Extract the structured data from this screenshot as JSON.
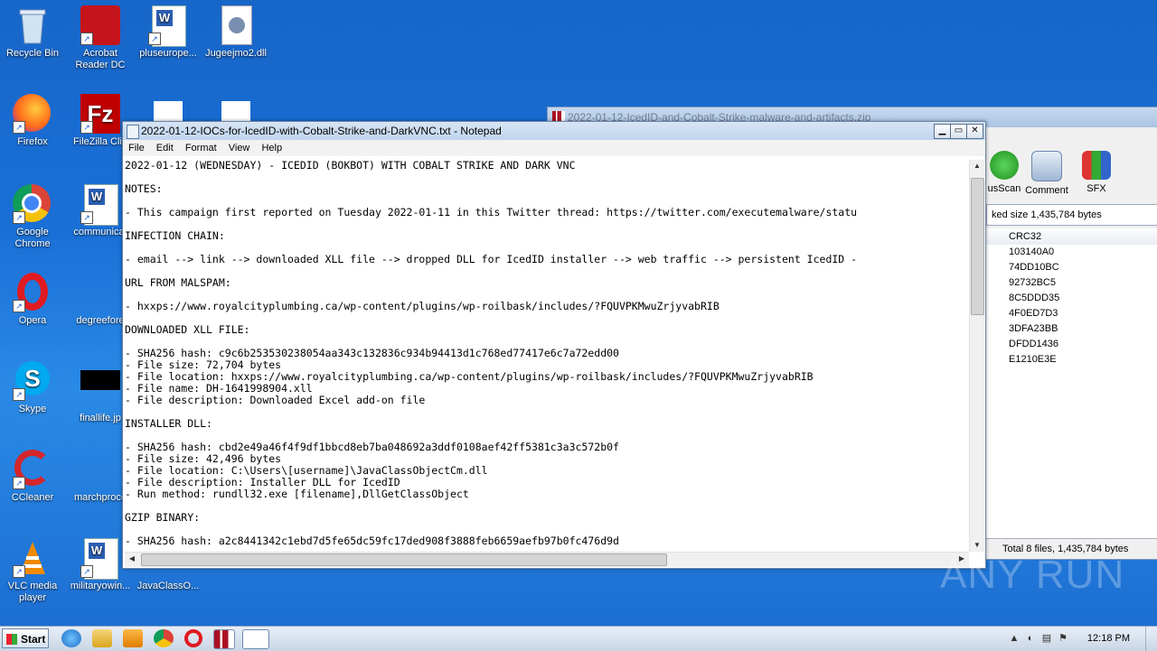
{
  "desktop": {
    "icons": [
      {
        "label": "Recycle Bin"
      },
      {
        "label": "Acrobat Reader DC"
      },
      {
        "label": "pluseurope..."
      },
      {
        "label": "Jugeejmo2.dll"
      },
      {
        "label": "Firefox"
      },
      {
        "label": "FileZilla Clie"
      },
      {
        "label": "Google Chrome"
      },
      {
        "label": "communicat"
      },
      {
        "label": "Opera"
      },
      {
        "label": "degreefore"
      },
      {
        "label": "Skype"
      },
      {
        "label": "finallife.jp"
      },
      {
        "label": "CCleaner"
      },
      {
        "label": "marchproce"
      },
      {
        "label": "VLC media player"
      },
      {
        "label": "militaryowin..."
      },
      {
        "label": "JavaClassO..."
      }
    ]
  },
  "archive_window": {
    "title": "2022-01-12-IcedID-and-Cobalt-Strike-malware-and-artifacts.zip",
    "toolbar": [
      "usScan",
      "Comment",
      "SFX"
    ],
    "info_text": "ked size 1,435,784 bytes",
    "column_header": "CRC32",
    "crc_values": [
      "103140A0",
      "74DD10BC",
      "92732BC5",
      "8C5DDD35",
      "4F0ED7D3",
      "3DFA23BB",
      "DFDD1436",
      "E1210E3E"
    ],
    "status": "Total 8 files, 1,435,784 bytes"
  },
  "notepad": {
    "title": "2022-01-12-IOCs-for-IcedID-with-Cobalt-Strike-and-DarkVNC.txt - Notepad",
    "menu": [
      "File",
      "Edit",
      "Format",
      "View",
      "Help"
    ],
    "lines": [
      "2022-01-12 (WEDNESDAY) - ICEDID (BOKBOT) WITH COBALT STRIKE AND DARK VNC",
      "",
      "NOTES:",
      "",
      "- This campaign first reported on Tuesday 2022-01-11 in this Twitter thread: https://twitter.com/executemalware/statu",
      "",
      "INFECTION CHAIN:",
      "",
      "- email --> link --> downloaded XLL file --> dropped DLL for IcedID installer --> web traffic --> persistent IcedID -",
      "",
      "URL FROM MALSPAM:",
      "",
      "- hxxps://www.royalcityplumbing.ca/wp-content/plugins/wp-roilbask/includes/?FQUVPKMwuZrjyvabRIB",
      "",
      "DOWNLOADED XLL FILE:",
      "",
      "- SHA256 hash: c9c6b253530238054aa343c132836c934b94413d1c768ed77417e6c7a72edd00",
      "- File size: 72,704 bytes",
      "- File location: hxxps://www.royalcityplumbing.ca/wp-content/plugins/wp-roilbask/includes/?FQUVPKMwuZrjyvabRIB",
      "- File name: DH-1641998904.xll",
      "- File description: Downloaded Excel add-on file",
      "",
      "INSTALLER DLL:",
      "",
      "- SHA256 hash: cbd2e49a46f4f9df1bbcd8eb7ba048692a3ddf0108aef42ff5381c3a3c572b0f",
      "- File size: 42,496 bytes",
      "- File location: C:\\Users\\[username]\\JavaClassObjectCm.dll",
      "- File description: Installer DLL for IcedID",
      "- Run method: rundll32.exe [filename],DllGetClassObject",
      "",
      "GZIP BINARY:",
      "",
      "- SHA256 hash: a2c8441342c1ebd7d5fe65dc59fc17ded908f3888feb6659aefb97b0fc476d9d"
    ]
  },
  "watermark": "ANY RUN",
  "taskbar": {
    "start_label": "Start",
    "time": "12:18 PM"
  }
}
